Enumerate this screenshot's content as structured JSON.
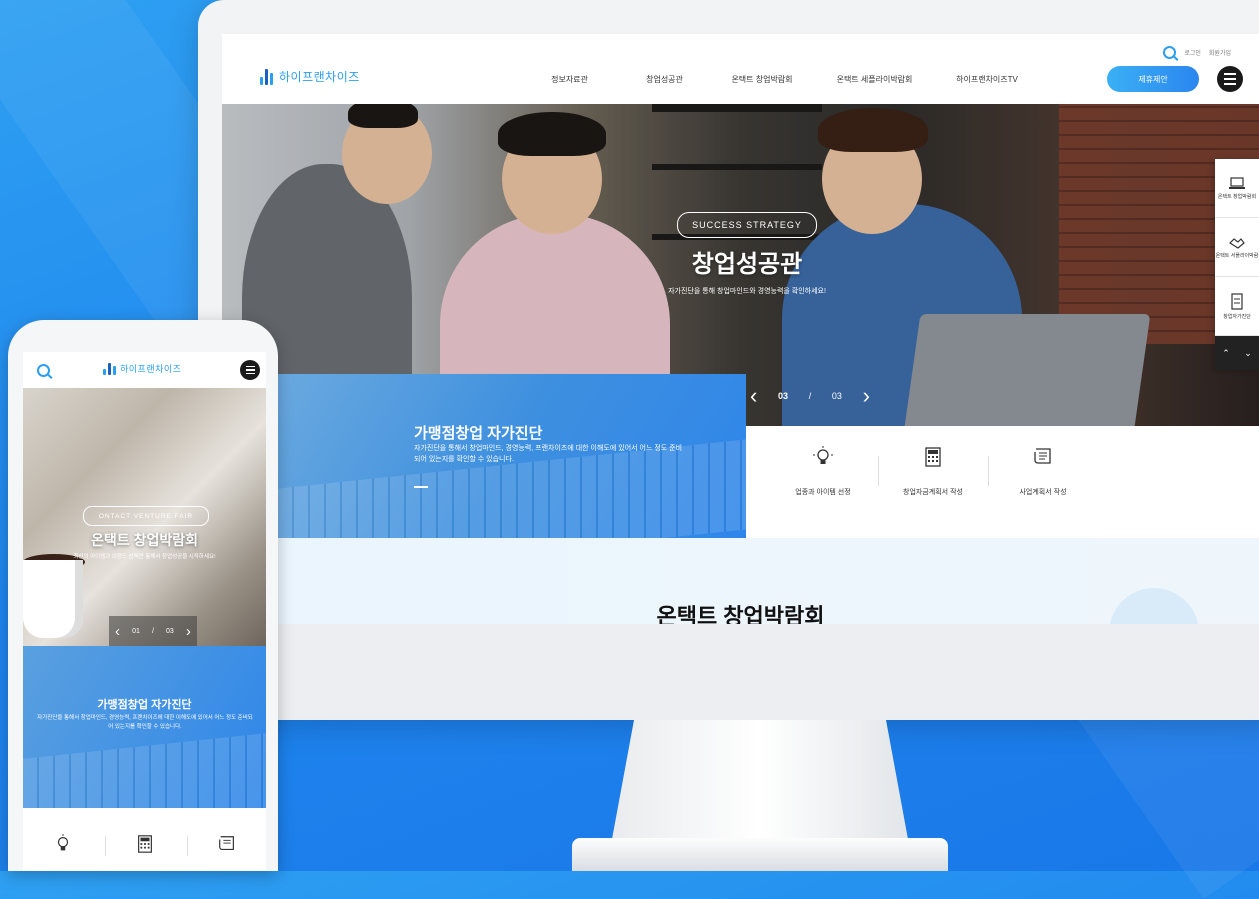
{
  "desktop": {
    "logo_text": "하이프랜차이즈",
    "nav": [
      "정보자료관",
      "창업성공관",
      "온택트 창업박람회",
      "온택트 세플라이박람회",
      "하이프랜차이즈TV"
    ],
    "util_links": [
      "로그인",
      "회원가입"
    ],
    "cta_label": "제휴제안",
    "hero": {
      "badge": "SUCCESS STRATEGY",
      "title": "창업성공관",
      "subtitle": "자가진단을 통해 창업마인드와 경영능력을 확인하세요!",
      "page_current": "03",
      "page_separator": "/",
      "page_total": "03"
    },
    "side_menu": [
      {
        "icon": "laptop-icon",
        "label": "온택트 창업박람회"
      },
      {
        "icon": "handshake-icon",
        "label": "온택트 서플라이박람"
      },
      {
        "icon": "checklist-icon",
        "label": "창업자가진단"
      }
    ],
    "diagnosis": {
      "title": "가맹점창업 자가진단",
      "text": "자가진단을 통해서 창업마인드, 경영능력, 프랜차이즈에 대한 이해도에 있어서 어느 정도 준비되어 있는지를 확인할 수 있습니다."
    },
    "icon_tiles": [
      {
        "icon": "lightbulb-icon",
        "label": "업종과 아이템 선정"
      },
      {
        "icon": "calculator-icon",
        "label": "창업자금계획서 작성"
      },
      {
        "icon": "document-icon",
        "label": "사업계획서 작성"
      }
    ],
    "section_title": "온택트 창업박람회"
  },
  "mobile": {
    "logo_text": "하이프랜차이즈",
    "hero": {
      "badge": "ONTACT VENTURE FAIR",
      "title": "온택트 창업박람회",
      "subtitle": "최신의 아이템과 브랜드 선택만 통해서 창업성공을 시작하세요!",
      "page_current": "01",
      "page_separator": "/",
      "page_total": "03"
    },
    "diagnosis": {
      "title": "가맹점창업 자가진단",
      "text": "자가진단을 통해서 창업마인드, 경영능력, 프랜차이즈에 대한 이해도에 있어서 어느 정도 준비되어 있는지를 확인할 수 있습니다."
    },
    "icons": [
      "lightbulb-icon",
      "calculator-icon",
      "document-icon"
    ]
  },
  "colors": {
    "brand_blue": "#2b9ef0",
    "background": "#1f86ee",
    "dark": "#1a1a1a"
  }
}
